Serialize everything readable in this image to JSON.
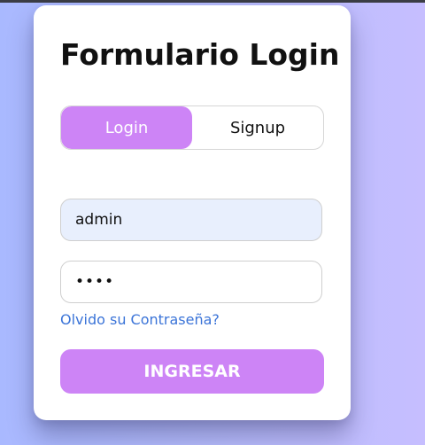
{
  "form": {
    "title": "Formulario Login",
    "tabs": [
      {
        "label": "Login",
        "active": true
      },
      {
        "label": "Signup",
        "active": false
      }
    ],
    "username": {
      "value": "admin"
    },
    "password": {
      "value": "••••"
    },
    "forgot_link": "Olvido su Contraseña?",
    "submit_label": "INGRESAR"
  },
  "colors": {
    "accent": "#cd84f6",
    "link": "#3b74d8",
    "background_start": "#a9b9ff",
    "background_end": "#c6beff"
  }
}
